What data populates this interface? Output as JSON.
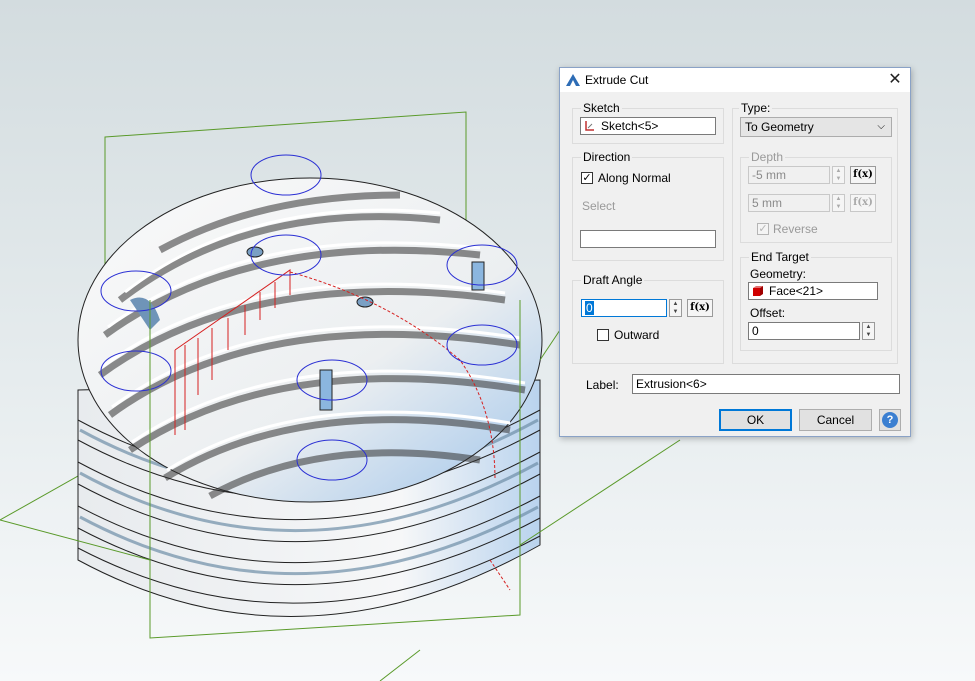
{
  "dialog": {
    "title": "Extrude Cut",
    "sketch": {
      "label": "Sketch",
      "value": "Sketch<5>"
    },
    "direction": {
      "label": "Direction",
      "along_normal": "Along Normal",
      "along_normal_checked": true,
      "select": "Select",
      "select_value": ""
    },
    "draft_angle": {
      "label": "Draft Angle",
      "value": "0",
      "outward": "Outward",
      "outward_checked": false
    },
    "type": {
      "label": "Type:",
      "value": "To Geometry"
    },
    "depth": {
      "label": "Depth",
      "value1": "-5 mm",
      "value2": "5 mm",
      "reverse": "Reverse",
      "reverse_checked": true
    },
    "end_target": {
      "label": "End Target",
      "geometry_label": "Geometry:",
      "geometry_value": "Face<21>",
      "offset_label": "Offset:",
      "offset_value": "0"
    },
    "label_field": {
      "label": "Label:",
      "value": "Extrusion<6>"
    },
    "buttons": {
      "ok": "OK",
      "cancel": "Cancel"
    }
  },
  "icons": {
    "fx": "f(x)",
    "help": "?",
    "close": "✕",
    "spin_up": "▲",
    "spin_down": "▼",
    "combo_arrow": "⌵"
  },
  "colors": {
    "accent": "#0078d7",
    "model": "#f2f4f6",
    "plane": "#5a9a2a",
    "circles": "#2a2fd4",
    "sketch_lines": "#d62020"
  }
}
